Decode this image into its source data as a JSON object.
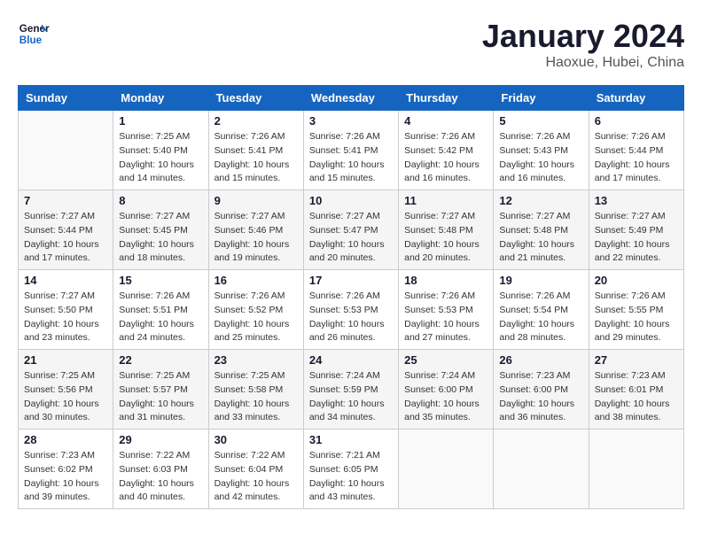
{
  "logo": {
    "text_general": "General",
    "text_blue": "Blue"
  },
  "header": {
    "title": "January 2024",
    "subtitle": "Haoxue, Hubei, China"
  },
  "weekdays": [
    "Sunday",
    "Monday",
    "Tuesday",
    "Wednesday",
    "Thursday",
    "Friday",
    "Saturday"
  ],
  "weeks": [
    [
      {
        "day": "",
        "sunrise": "",
        "sunset": "",
        "daylight": ""
      },
      {
        "day": "1",
        "sunrise": "Sunrise: 7:25 AM",
        "sunset": "Sunset: 5:40 PM",
        "daylight": "Daylight: 10 hours and 14 minutes."
      },
      {
        "day": "2",
        "sunrise": "Sunrise: 7:26 AM",
        "sunset": "Sunset: 5:41 PM",
        "daylight": "Daylight: 10 hours and 15 minutes."
      },
      {
        "day": "3",
        "sunrise": "Sunrise: 7:26 AM",
        "sunset": "Sunset: 5:41 PM",
        "daylight": "Daylight: 10 hours and 15 minutes."
      },
      {
        "day": "4",
        "sunrise": "Sunrise: 7:26 AM",
        "sunset": "Sunset: 5:42 PM",
        "daylight": "Daylight: 10 hours and 16 minutes."
      },
      {
        "day": "5",
        "sunrise": "Sunrise: 7:26 AM",
        "sunset": "Sunset: 5:43 PM",
        "daylight": "Daylight: 10 hours and 16 minutes."
      },
      {
        "day": "6",
        "sunrise": "Sunrise: 7:26 AM",
        "sunset": "Sunset: 5:44 PM",
        "daylight": "Daylight: 10 hours and 17 minutes."
      }
    ],
    [
      {
        "day": "7",
        "sunrise": "Sunrise: 7:27 AM",
        "sunset": "Sunset: 5:44 PM",
        "daylight": "Daylight: 10 hours and 17 minutes."
      },
      {
        "day": "8",
        "sunrise": "Sunrise: 7:27 AM",
        "sunset": "Sunset: 5:45 PM",
        "daylight": "Daylight: 10 hours and 18 minutes."
      },
      {
        "day": "9",
        "sunrise": "Sunrise: 7:27 AM",
        "sunset": "Sunset: 5:46 PM",
        "daylight": "Daylight: 10 hours and 19 minutes."
      },
      {
        "day": "10",
        "sunrise": "Sunrise: 7:27 AM",
        "sunset": "Sunset: 5:47 PM",
        "daylight": "Daylight: 10 hours and 20 minutes."
      },
      {
        "day": "11",
        "sunrise": "Sunrise: 7:27 AM",
        "sunset": "Sunset: 5:48 PM",
        "daylight": "Daylight: 10 hours and 20 minutes."
      },
      {
        "day": "12",
        "sunrise": "Sunrise: 7:27 AM",
        "sunset": "Sunset: 5:48 PM",
        "daylight": "Daylight: 10 hours and 21 minutes."
      },
      {
        "day": "13",
        "sunrise": "Sunrise: 7:27 AM",
        "sunset": "Sunset: 5:49 PM",
        "daylight": "Daylight: 10 hours and 22 minutes."
      }
    ],
    [
      {
        "day": "14",
        "sunrise": "Sunrise: 7:27 AM",
        "sunset": "Sunset: 5:50 PM",
        "daylight": "Daylight: 10 hours and 23 minutes."
      },
      {
        "day": "15",
        "sunrise": "Sunrise: 7:26 AM",
        "sunset": "Sunset: 5:51 PM",
        "daylight": "Daylight: 10 hours and 24 minutes."
      },
      {
        "day": "16",
        "sunrise": "Sunrise: 7:26 AM",
        "sunset": "Sunset: 5:52 PM",
        "daylight": "Daylight: 10 hours and 25 minutes."
      },
      {
        "day": "17",
        "sunrise": "Sunrise: 7:26 AM",
        "sunset": "Sunset: 5:53 PM",
        "daylight": "Daylight: 10 hours and 26 minutes."
      },
      {
        "day": "18",
        "sunrise": "Sunrise: 7:26 AM",
        "sunset": "Sunset: 5:53 PM",
        "daylight": "Daylight: 10 hours and 27 minutes."
      },
      {
        "day": "19",
        "sunrise": "Sunrise: 7:26 AM",
        "sunset": "Sunset: 5:54 PM",
        "daylight": "Daylight: 10 hours and 28 minutes."
      },
      {
        "day": "20",
        "sunrise": "Sunrise: 7:26 AM",
        "sunset": "Sunset: 5:55 PM",
        "daylight": "Daylight: 10 hours and 29 minutes."
      }
    ],
    [
      {
        "day": "21",
        "sunrise": "Sunrise: 7:25 AM",
        "sunset": "Sunset: 5:56 PM",
        "daylight": "Daylight: 10 hours and 30 minutes."
      },
      {
        "day": "22",
        "sunrise": "Sunrise: 7:25 AM",
        "sunset": "Sunset: 5:57 PM",
        "daylight": "Daylight: 10 hours and 31 minutes."
      },
      {
        "day": "23",
        "sunrise": "Sunrise: 7:25 AM",
        "sunset": "Sunset: 5:58 PM",
        "daylight": "Daylight: 10 hours and 33 minutes."
      },
      {
        "day": "24",
        "sunrise": "Sunrise: 7:24 AM",
        "sunset": "Sunset: 5:59 PM",
        "daylight": "Daylight: 10 hours and 34 minutes."
      },
      {
        "day": "25",
        "sunrise": "Sunrise: 7:24 AM",
        "sunset": "Sunset: 6:00 PM",
        "daylight": "Daylight: 10 hours and 35 minutes."
      },
      {
        "day": "26",
        "sunrise": "Sunrise: 7:23 AM",
        "sunset": "Sunset: 6:00 PM",
        "daylight": "Daylight: 10 hours and 36 minutes."
      },
      {
        "day": "27",
        "sunrise": "Sunrise: 7:23 AM",
        "sunset": "Sunset: 6:01 PM",
        "daylight": "Daylight: 10 hours and 38 minutes."
      }
    ],
    [
      {
        "day": "28",
        "sunrise": "Sunrise: 7:23 AM",
        "sunset": "Sunset: 6:02 PM",
        "daylight": "Daylight: 10 hours and 39 minutes."
      },
      {
        "day": "29",
        "sunrise": "Sunrise: 7:22 AM",
        "sunset": "Sunset: 6:03 PM",
        "daylight": "Daylight: 10 hours and 40 minutes."
      },
      {
        "day": "30",
        "sunrise": "Sunrise: 7:22 AM",
        "sunset": "Sunset: 6:04 PM",
        "daylight": "Daylight: 10 hours and 42 minutes."
      },
      {
        "day": "31",
        "sunrise": "Sunrise: 7:21 AM",
        "sunset": "Sunset: 6:05 PM",
        "daylight": "Daylight: 10 hours and 43 minutes."
      },
      {
        "day": "",
        "sunrise": "",
        "sunset": "",
        "daylight": ""
      },
      {
        "day": "",
        "sunrise": "",
        "sunset": "",
        "daylight": ""
      },
      {
        "day": "",
        "sunrise": "",
        "sunset": "",
        "daylight": ""
      }
    ]
  ]
}
